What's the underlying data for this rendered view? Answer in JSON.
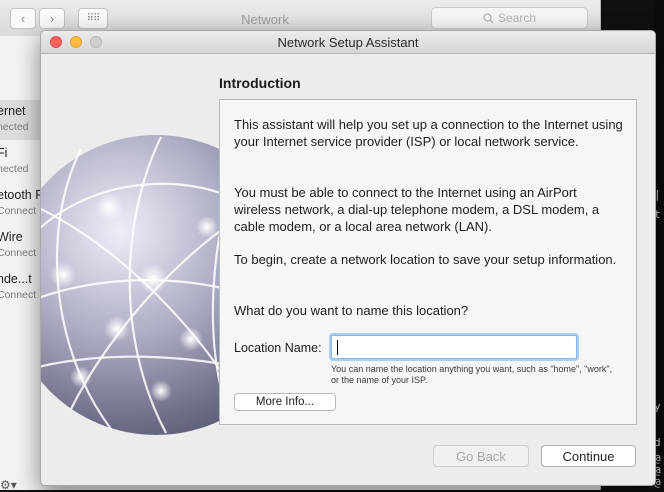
{
  "background_window": {
    "title": "Network",
    "nav_back_glyph": "‹",
    "nav_forward_glyph": "›",
    "grid_glyph": "⠿⠿",
    "search_placeholder": "Search",
    "sidebar_items": [
      {
        "name": "ernet",
        "status": "nected"
      },
      {
        "name": "Fi",
        "status": "nected"
      },
      {
        "name": "etooth P",
        "status": "Connect"
      },
      {
        "name": "Wire",
        "status": "Connect"
      },
      {
        "name": "nde...t",
        "status": "Connect"
      }
    ],
    "gear_glyph": "⚙︎▾"
  },
  "terminal_fragments": [
    "|",
    "t",
    "y",
    "d",
    "@",
    "@",
    "@"
  ],
  "sheet": {
    "title": "Network Setup Assistant",
    "section_title": "Introduction",
    "paragraphs": [
      "This assistant will help you set up a connection to the Internet using your Internet service provider (ISP) or local network service.",
      "You must be able to connect to the Internet using an AirPort wireless network, a dial-up telephone modem, a DSL modem, a cable modem, or a local area network (LAN).",
      "To begin, create a network location to save your setup information.",
      "What do you want to name this location?"
    ],
    "location_label": "Location Name:",
    "location_value": "",
    "location_hint": "You can name the location anything you want, such as \"home\", \"work\", or the name of your ISP.",
    "more_info_label": "More Info...",
    "go_back_label": "Go Back",
    "continue_label": "Continue"
  }
}
